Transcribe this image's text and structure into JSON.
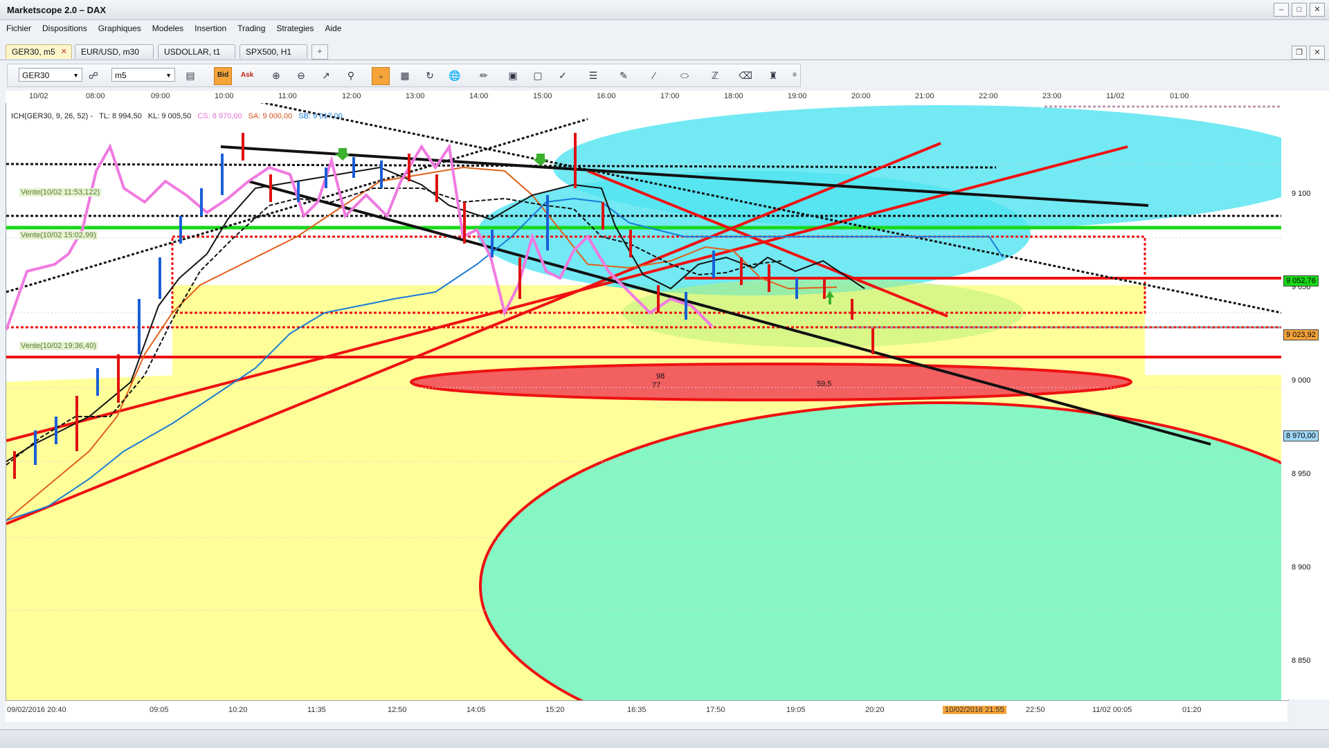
{
  "window": {
    "title": "Marketscope 2.0 – DAX"
  },
  "menu": [
    "Fichier",
    "Dispositions",
    "Graphiques",
    "Modeles",
    "Insertion",
    "Trading",
    "Strategies",
    "Aide"
  ],
  "tabs": [
    {
      "label": "GER30, m5",
      "active": true
    },
    {
      "label": "EUR/USD, m30",
      "active": false
    },
    {
      "label": "USDOLLAR, t1",
      "active": false
    },
    {
      "label": "SPX500, H1",
      "active": false
    }
  ],
  "toolbar": {
    "instrument": "GER30",
    "timeframe": "m5",
    "bid_label": "Bid",
    "ask_label": "Ask"
  },
  "indicator_label": "ICH(GER30, 9, 26, 52) -",
  "indicator_values": {
    "tl": "TL: 8 994,50",
    "kl": "KL: 9 005,50",
    "cs": "CS: 8 970,00",
    "sa": "SA: 9 000,00",
    "sb": "SB: 9 017,00"
  },
  "top_time_labels": [
    "10/02",
    "08:00",
    "09:00",
    "10:00",
    "11:00",
    "12:00",
    "13:00",
    "14:00",
    "15:00",
    "16:00",
    "17:00",
    "18:00",
    "19:00",
    "20:00",
    "21:00",
    "22:00",
    "23:00",
    "11/02",
    "01:00"
  ],
  "bottom_time_labels": [
    "09/02/2016 20:40",
    "09:05",
    "10:20",
    "11:35",
    "12:50",
    "14:05",
    "15:20",
    "16:35",
    "17:50",
    "19:05",
    "20:20",
    "22:50",
    "11/02 00:05",
    "01:20"
  ],
  "bottom_cursor_label": "10/02/2016 21:55",
  "price_labels": [
    "9 100",
    "9 050",
    "9 000",
    "8 950",
    "8 900",
    "8 850"
  ],
  "price_markers": {
    "green": "9 052,76",
    "orange": "9 023,92",
    "blue": "8 970,00"
  },
  "trade_labels": [
    "Vente(10/02 11:53,122)",
    "Vente(10/02 15:02,99)",
    "Vente(10/02 19:36,40)"
  ],
  "small_labels": [
    "77",
    "98",
    "59,5"
  ],
  "colors": {
    "accent": "#f6a43a",
    "cloud_yellow": "#ffff9a",
    "cloud_green": "#86f7c4",
    "cloud_cyan": "#4fe3f0",
    "line_red": "#ee1111",
    "tenkan_pink": "#f07ae0",
    "green_line": "#18d818"
  }
}
